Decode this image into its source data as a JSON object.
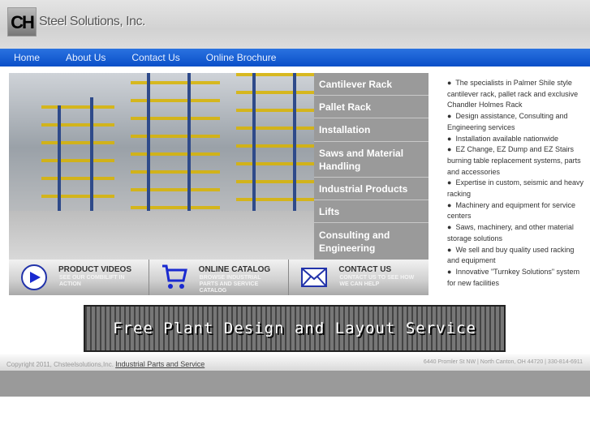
{
  "header": {
    "logo_mark": "CH",
    "logo_text": "Steel Solutions, Inc."
  },
  "nav": [
    "Home",
    "About Us",
    "Contact Us",
    "Online Brochure"
  ],
  "side_menu": [
    "Cantilever Rack",
    "Pallet Rack",
    "Installation",
    "Saws and Material Handling",
    "Industrial Products",
    "Lifts",
    "Consulting and Engineering"
  ],
  "promo_buttons": [
    {
      "title": "PRODUCT VIDEOS",
      "subtitle": "SEE OUR COMBILIFT IN ACTION",
      "icon": "play-icon"
    },
    {
      "title": "ONLINE CATALOG",
      "subtitle": "BROWSE INDUSTRIAL PARTS AND SERVICE CATALOG",
      "icon": "shopping-cart-icon"
    },
    {
      "title": "CONTACT US",
      "subtitle": "CONTACT US TO SEE HOW WE CAN HELP",
      "icon": "envelope-icon"
    }
  ],
  "bullets": [
    "The specialists in Palmer Shile style cantilever rack, pallet rack and exclusive Chandler Holmes Rack",
    "Design assistance, Consulting and Engineering services",
    "Installation available nationwide",
    "EZ Change, EZ Dump and EZ Stairs burning table replacement systems, parts and accessories",
    "Expertise in custom, seismic and heavy racking",
    "Machinery and equipment for service centers",
    "Saws, machinery, and other material storage solutions",
    "We sell and buy quality used racking and equipment",
    "Innovative \"Turnkey Solutions\" system for new facilities"
  ],
  "banner": "Free Plant Design and Layout Service",
  "footer": {
    "copyright": "Copyright 2011, Chsteelsolutions,Inc.",
    "link": "Industrial Parts and Service",
    "address": "6440 Promler St NW | North Canton, OH 44720 | 330-814-6911"
  },
  "colors": {
    "nav": "#0a4fc8",
    "menu": "#9a9a9a"
  }
}
